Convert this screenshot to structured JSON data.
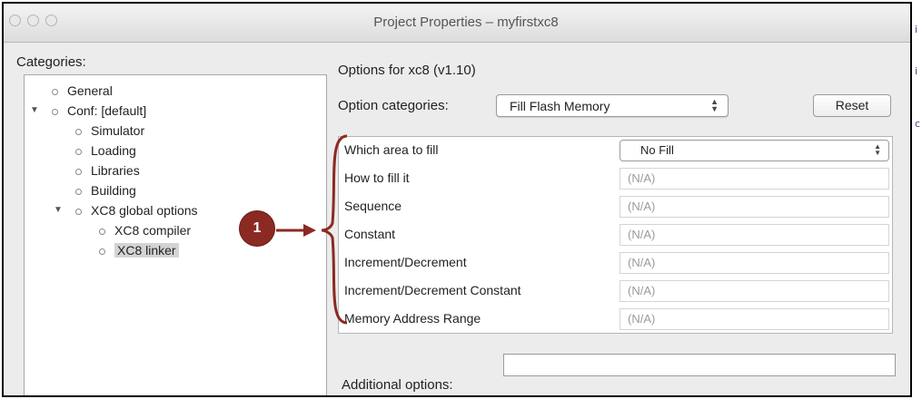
{
  "window": {
    "title": "Project Properties – myfirstxc8"
  },
  "categories": {
    "label": "Categories:",
    "items": [
      {
        "label": "General",
        "expanded": false
      },
      {
        "label": "Conf: [default]",
        "expanded": true
      },
      {
        "label": "Simulator"
      },
      {
        "label": "Loading"
      },
      {
        "label": "Libraries"
      },
      {
        "label": "Building"
      },
      {
        "label": "XC8 global options",
        "expanded": true
      },
      {
        "label": "XC8 compiler"
      },
      {
        "label": "XC8 linker",
        "selected": true
      }
    ]
  },
  "options": {
    "heading": "Options for xc8 (v1.10)",
    "category_label": "Option categories:",
    "category_value": "Fill Flash Memory",
    "reset_label": "Reset",
    "rows": [
      {
        "name": "Which area to fill",
        "value": "No Fill",
        "is_select": true
      },
      {
        "name": "How to fill it",
        "value": "(N/A)"
      },
      {
        "name": "Sequence",
        "value": "(N/A)"
      },
      {
        "name": "Constant",
        "value": "(N/A)"
      },
      {
        "name": "Increment/Decrement",
        "value": "(N/A)"
      },
      {
        "name": "Increment/Decrement Constant",
        "value": "(N/A)"
      },
      {
        "name": "Memory Address Range",
        "value": "(N/A)"
      }
    ],
    "additional_label": "Additional options:",
    "additional_value": ""
  },
  "annotation": {
    "callout_number": "1",
    "color": "#8b2a22"
  },
  "side_glyphs": [
    "i",
    "i",
    "c"
  ]
}
